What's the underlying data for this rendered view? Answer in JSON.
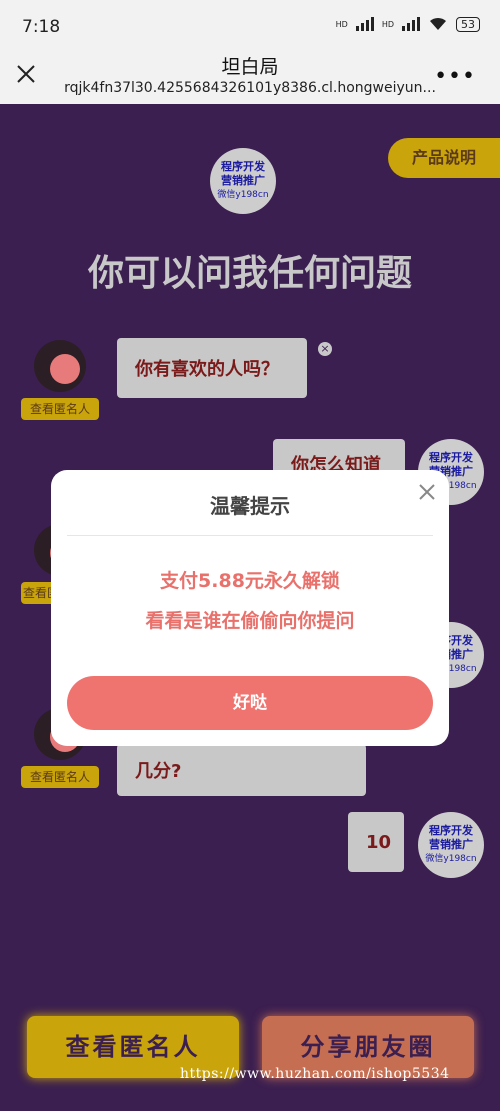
{
  "status": {
    "time": "7:18",
    "hd1": "HD",
    "hd2": "HD",
    "battery": "53"
  },
  "nav": {
    "title": "坦白局",
    "url": "rqjk4fn37l30.4255684326101y8386.cl.hongweiyun...",
    "more": "•••"
  },
  "header": {
    "product_button": "产品说明",
    "badge": {
      "line1": "程序开发",
      "line2": "营销推广",
      "line3": "微信y198cn"
    },
    "headline": "你可以问我任何问题"
  },
  "chat": {
    "anon_tag": "查看匿名人",
    "q1": "你有喜欢的人吗？",
    "r1": "你怎么知道",
    "q_last": "几分?",
    "r_last": "10",
    "close": "×"
  },
  "modal": {
    "title": "温馨提示",
    "line1": "支付5.88元永久解锁",
    "line2": "看看是谁在偷偷向你提问",
    "ok": "好哒"
  },
  "footer": {
    "view_button": "查看匿名人",
    "share_button": "分享朋友圈",
    "watermark": "https://www.huzhan.com/ishop5534"
  }
}
